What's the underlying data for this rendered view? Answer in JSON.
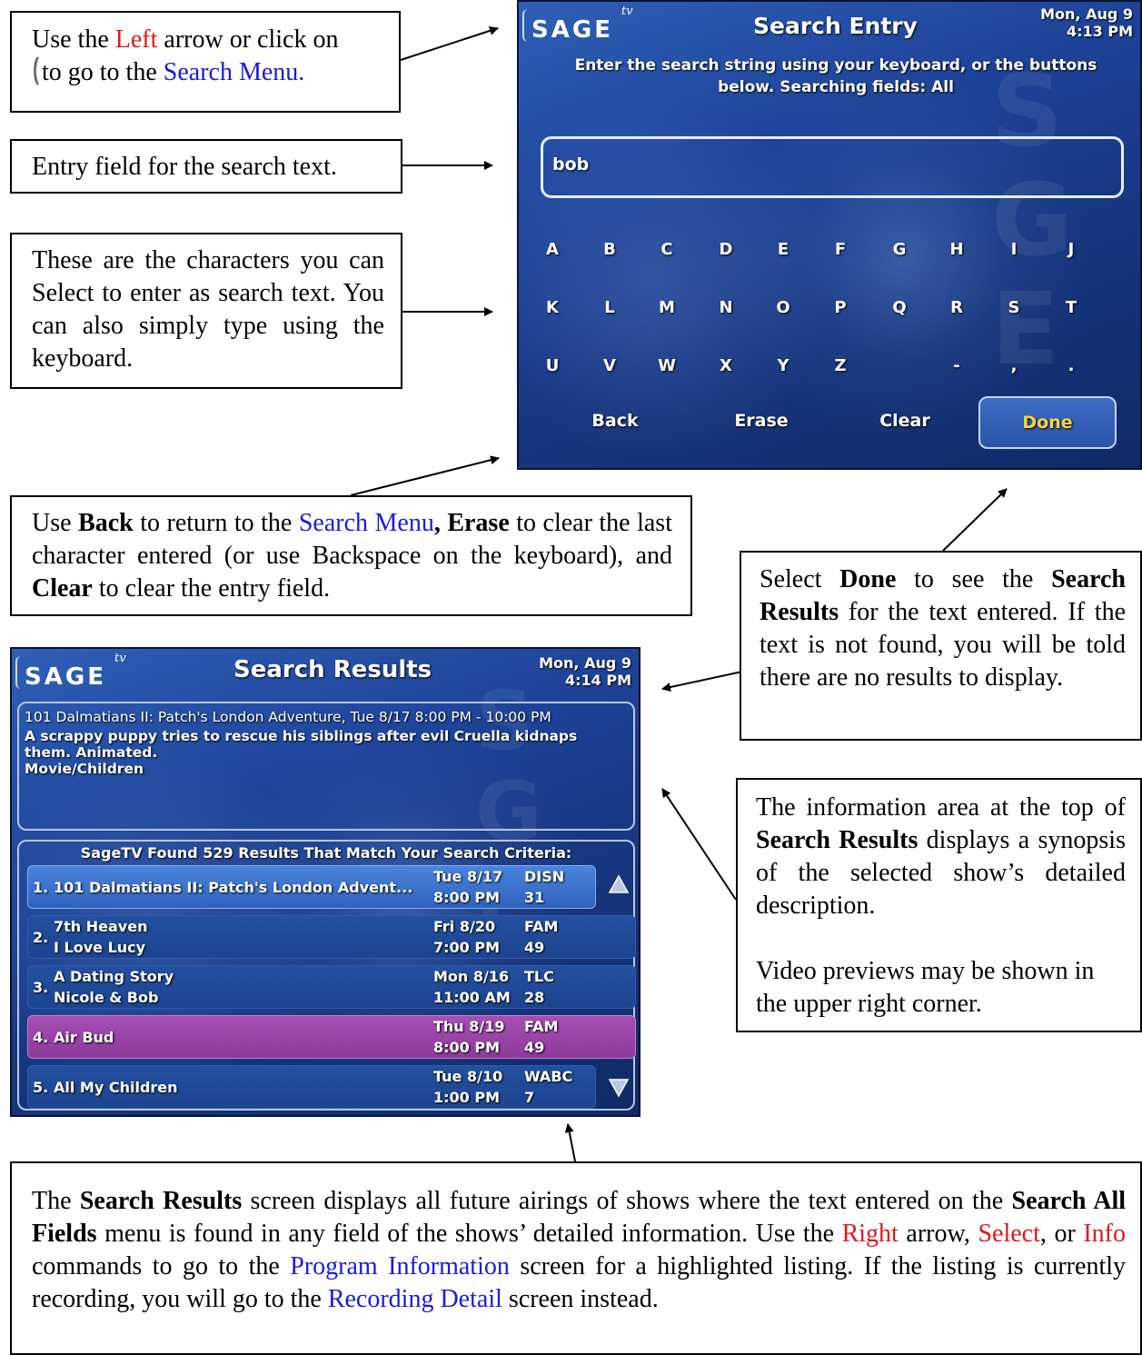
{
  "callouts": {
    "left_arrow": {
      "p1": "Use the ",
      "left": "Left",
      "p2": " arrow or click on",
      "p3": "to go to the ",
      "search_menu": "Search Menu",
      "p4": "."
    },
    "entry_field": "Entry field for the search text.",
    "characters": "These are the characters you can Select to enter as search text. You can also simply type using the keyboard.",
    "buttons": {
      "p1": "Use ",
      "back": "Back",
      "p2": " to return to the ",
      "search_menu": "Search Menu",
      "comma": ",",
      "erase": " Erase",
      "p3": " to clear the last character entered (or use Backspace on the keyboard), and ",
      "clear": "Clear",
      "p4": " to clear the entry field."
    },
    "done": {
      "p1": "Select ",
      "done": "Done",
      "p2": " to see the ",
      "search_results": "Search Results",
      "p3": " for the text entered. If the text is not found, you will be told there are no results to display."
    },
    "info_area": {
      "p1": "The information area at the top of ",
      "search_results": "Search Results",
      "p2": " displays a synopsis of the selected show’s detailed  description.",
      "p3": "Video previews may be shown in the upper right corner."
    },
    "bottom": {
      "p1": "The ",
      "search_results": "Search Results",
      "p2": " screen displays all future airings of shows where the text entered on the ",
      "search_all": "Search All Fields",
      "p3": " menu is found in any field of the shows’ detailed information. Use the ",
      "right": "Right",
      "p4": " arrow, ",
      "select": "Select",
      "p5": ", or ",
      "info": "Info",
      "p6": " commands to go to the ",
      "program_info": "Program Information",
      "p7": " screen for a highlighted listing. If the listing is currently recording, you will go to the ",
      "recording_detail": "Recording Detail",
      "p8": " screen instead."
    }
  },
  "search_entry_screen": {
    "logo": "SAGE",
    "logo_tv": "tv",
    "title": "Search Entry",
    "date_line1": "Mon, Aug 9",
    "date_line2": "4:13 PM",
    "instruction": "Enter the search string using your keyboard, or the buttons below. Searching fields: All",
    "entry_value": "bob",
    "keys": [
      [
        "A",
        "B",
        "C",
        "D",
        "E",
        "F",
        "G",
        "H",
        "I",
        "J"
      ],
      [
        "K",
        "L",
        "M",
        "N",
        "O",
        "P",
        "Q",
        "R",
        "S",
        "T"
      ],
      [
        "U",
        "V",
        "W",
        "X",
        "Y",
        "Z",
        "",
        "-",
        ",",
        "."
      ]
    ],
    "buttons": {
      "back": "Back",
      "erase": "Erase",
      "clear": "Clear",
      "done": "Done"
    }
  },
  "search_results_screen": {
    "logo": "SAGE",
    "logo_tv": "tv",
    "title": "Search Results",
    "date_line1": "Mon, Aug 9",
    "date_line2": "4:14 PM",
    "info_line1": "101 Dalmatians II: Patch's London Adventure, Tue 8/17 8:00 PM - 10:00 PM",
    "info_line2": "A scrappy puppy tries to rescue his siblings after evil Cruella kidnaps them. Animated.",
    "info_line3": "Movie/Children",
    "results_header": "SageTV Found 529 Results That Match Your Search Criteria:",
    "rows": [
      {
        "num": "1.",
        "title1": "101 Dalmatians II: Patch's London Advent...",
        "title2": "",
        "day": "Tue 8/17",
        "time": "8:00 PM",
        "channel": "DISN",
        "chnum": "31"
      },
      {
        "num": "2.",
        "title1": "7th Heaven",
        "title2": "I Love Lucy",
        "day": "Fri 8/20",
        "time": "7:00 PM",
        "channel": "FAM",
        "chnum": "49"
      },
      {
        "num": "3.",
        "title1": "A Dating Story",
        "title2": "Nicole & Bob",
        "day": "Mon 8/16",
        "time": "11:00 AM",
        "channel": "TLC",
        "chnum": "28"
      },
      {
        "num": "4.",
        "title1": "Air Bud",
        "title2": "",
        "day": "Thu 8/19",
        "time": "8:00 PM",
        "channel": "FAM",
        "chnum": "49"
      },
      {
        "num": "5.",
        "title1": "All My Children",
        "title2": "",
        "day": "Tue 8/10",
        "time": "1:00 PM",
        "channel": "WABC",
        "chnum": "7"
      }
    ]
  }
}
